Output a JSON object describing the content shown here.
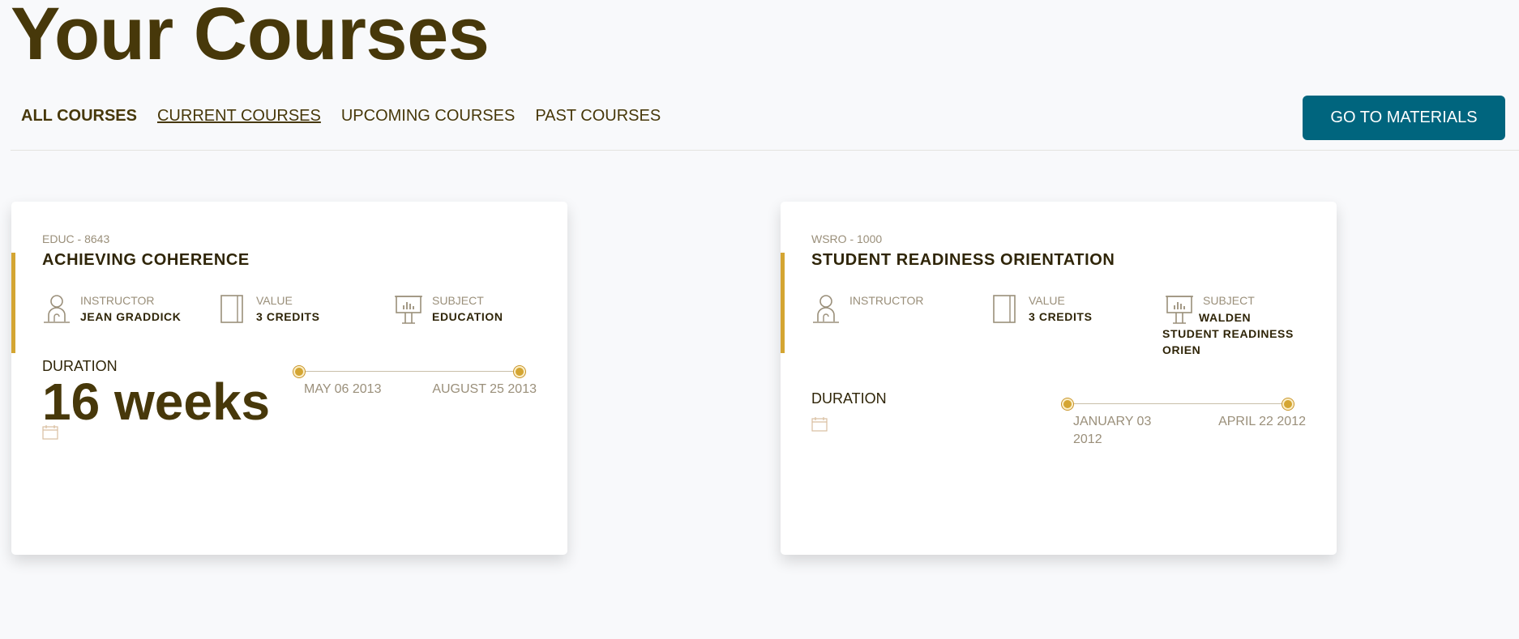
{
  "page": {
    "title": "Your Courses"
  },
  "tabs": [
    {
      "label": "ALL COURSES"
    },
    {
      "label": "CURRENT COURSES"
    },
    {
      "label": "UPCOMING COURSES"
    },
    {
      "label": "PAST COURSES"
    }
  ],
  "materials_button": {
    "label": "GO TO MATERIALS"
  },
  "courses": [
    {
      "code": "EDUC - 8643",
      "name": "ACHIEVING COHERENCE",
      "instructor_label": "INSTRUCTOR",
      "instructor": "JEAN GRADDICK",
      "value_label": "VALUE",
      "value": "3 CREDITS",
      "subject_label": "SUBJECT",
      "subject": "EDUCATION",
      "duration_label": "DURATION",
      "duration": "16 weeks",
      "start_date": "MAY 06 2013",
      "end_date": "AUGUST 25 2013"
    },
    {
      "code": "WSRO - 1000",
      "name": "STUDENT READINESS ORIENTATION",
      "instructor_label": "INSTRUCTOR",
      "instructor": "",
      "value_label": "VALUE",
      "value": "3 CREDITS",
      "subject_label": "SUBJECT",
      "subject": "WALDEN STUDENT READINESS ORIEN",
      "duration_label": "DURATION",
      "duration": "",
      "start_date": "JANUARY 03 2012",
      "end_date": "APRIL 22 2012"
    }
  ],
  "icons": {
    "instructor": "instructor-icon",
    "value": "book-icon",
    "subject": "presentation-board-icon",
    "calendar": "calendar-icon"
  },
  "colors": {
    "heading": "#47380a",
    "accent": "#d4a532",
    "button": "#00657e",
    "muted": "#9a8f7a"
  }
}
